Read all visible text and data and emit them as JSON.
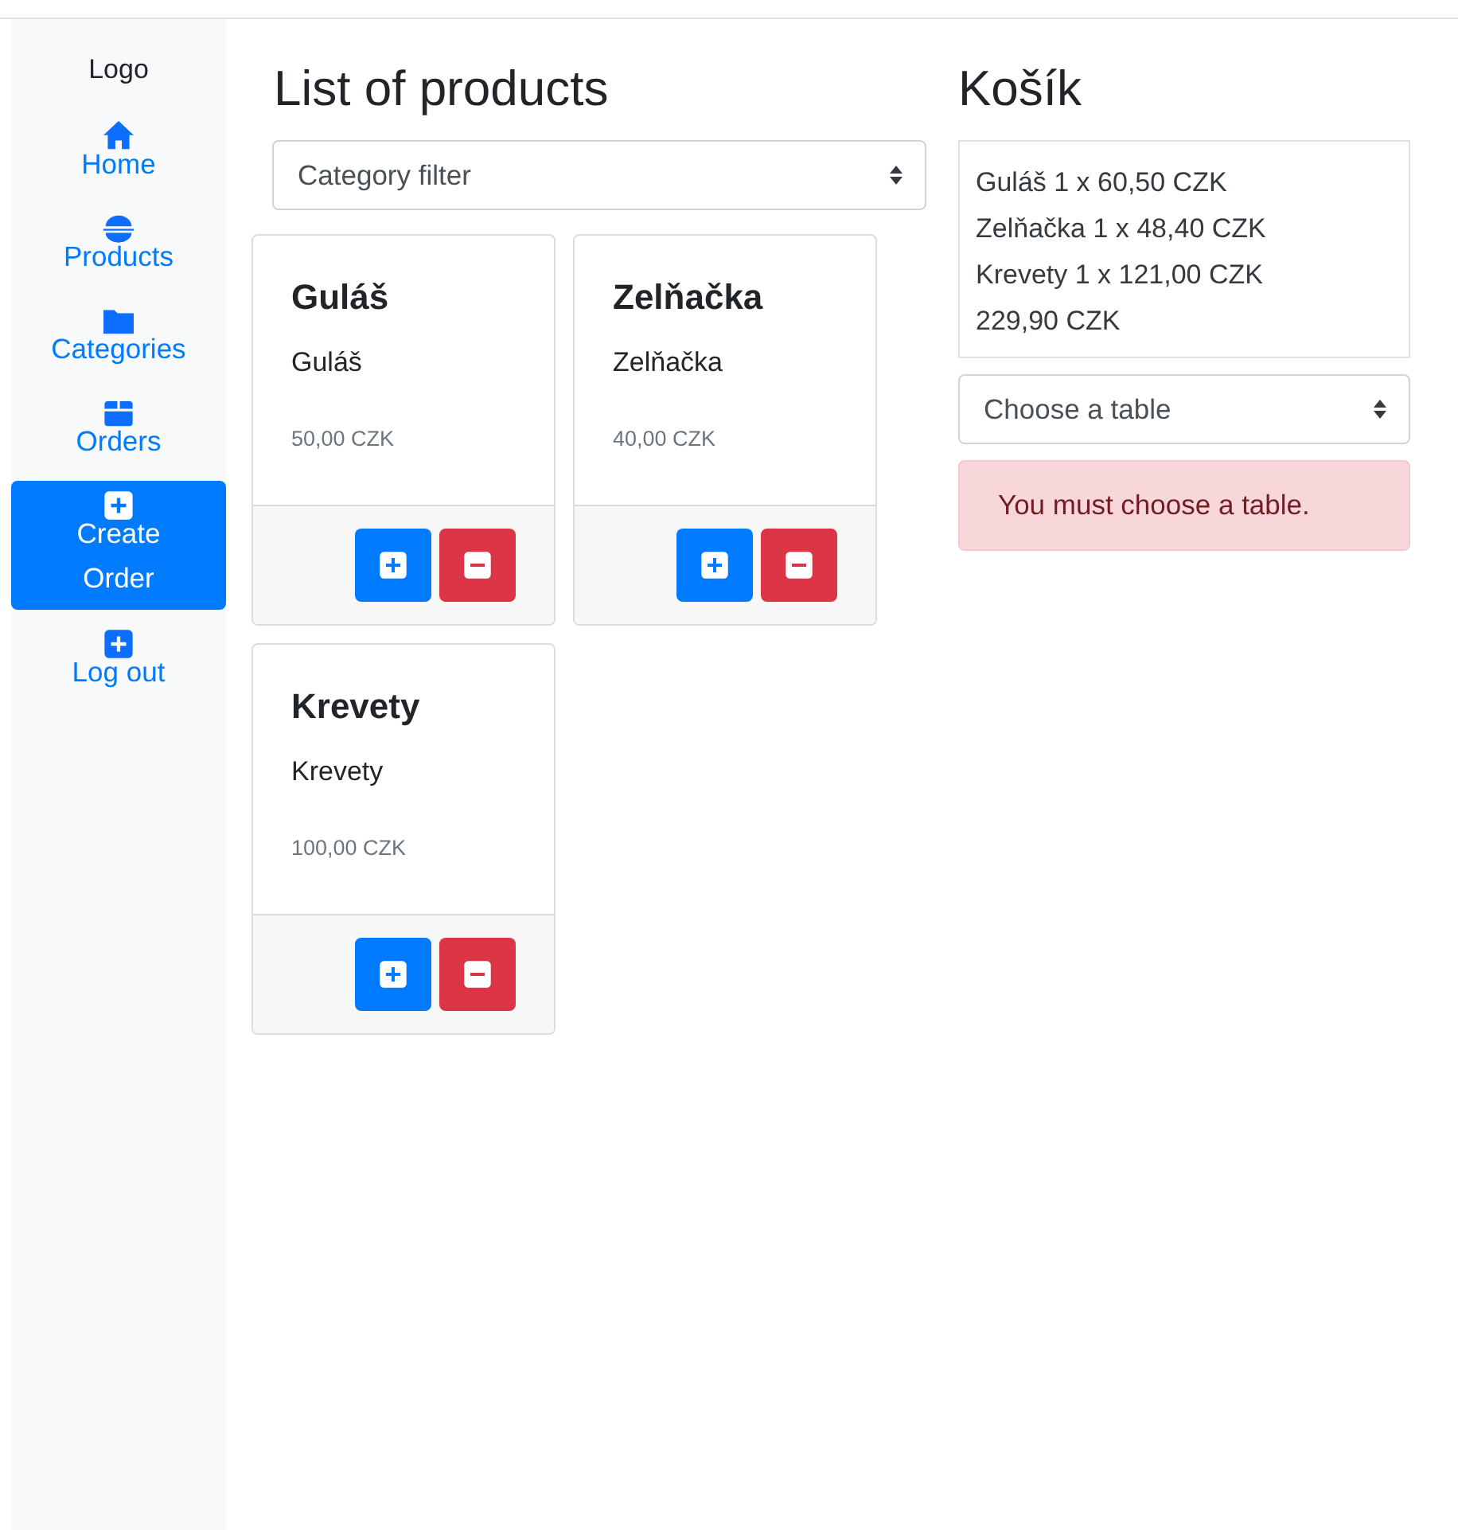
{
  "sidebar": {
    "logo": "Logo",
    "items": [
      {
        "label": "Home",
        "selected": false
      },
      {
        "label": "Products",
        "selected": false
      },
      {
        "label": "Categories",
        "selected": false
      },
      {
        "label": "Orders",
        "selected": false
      },
      {
        "label": "Create Order",
        "selected": true
      },
      {
        "label": "Log out",
        "selected": false
      }
    ]
  },
  "products": {
    "title": "List of products",
    "filter": {
      "placeholder": "Category filter"
    },
    "cards": [
      {
        "title": "Guláš",
        "description": "Guláš",
        "price": "50,00 CZK"
      },
      {
        "title": "Zelňačka",
        "description": "Zelňačka",
        "price": "40,00 CZK"
      },
      {
        "title": "Krevety",
        "description": "Krevety",
        "price": "100,00 CZK"
      }
    ]
  },
  "cart": {
    "title": "Košík",
    "lines": [
      "Guláš 1 x 60,50 CZK",
      "Zelňačka 1 x 48,40 CZK",
      "Krevety 1 x 121,00 CZK",
      "229,90 CZK"
    ],
    "table_select": {
      "placeholder": "Choose a table"
    },
    "alert": "You must choose a table."
  }
}
